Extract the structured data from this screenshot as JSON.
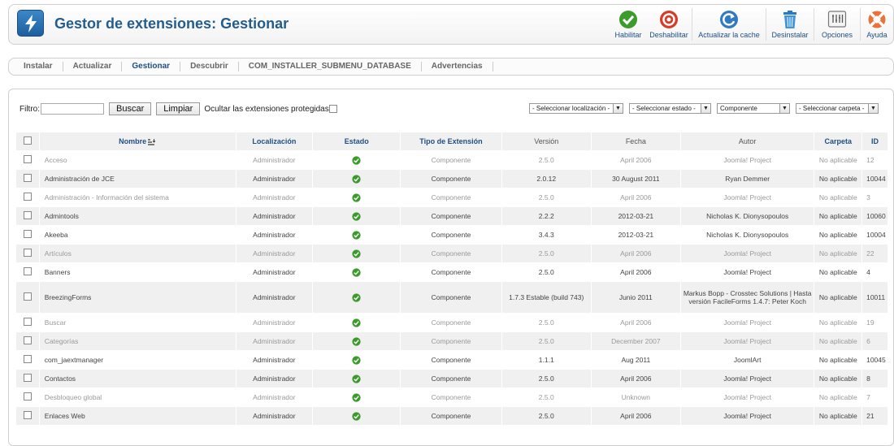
{
  "header": {
    "title": "Gestor de extensiones: Gestionar",
    "toolbar": [
      {
        "label": "Habilitar",
        "icon": "check-circle-icon"
      },
      {
        "label": "Deshabilitar",
        "icon": "stop-circle-icon"
      },
      {
        "label": "Actualizar la cache",
        "icon": "refresh-icon"
      },
      {
        "label": "Desinstalar",
        "icon": "trash-icon"
      },
      {
        "label": "Opciones",
        "icon": "options-icon"
      },
      {
        "label": "Ayuda",
        "icon": "lifebuoy-icon"
      }
    ]
  },
  "submenu": [
    {
      "label": "Instalar",
      "active": false
    },
    {
      "label": "Actualizar",
      "active": false
    },
    {
      "label": "Gestionar",
      "active": true
    },
    {
      "label": "Descubrir",
      "active": false
    },
    {
      "label": "COM_INSTALLER_SUBMENU_DATABASE",
      "active": false
    },
    {
      "label": "Advertencias",
      "active": false
    }
  ],
  "filter": {
    "label": "Filtro:",
    "value": "",
    "search_button": "Buscar",
    "clear_button": "Limpiar",
    "hide_protected_label": "Ocultar las extensiones protegidas"
  },
  "selects": {
    "location": "- Seleccionar localización -",
    "state": "- Seleccionar estado -",
    "type": "Componente",
    "folder": "- Seleccionar carpeta -"
  },
  "table": {
    "columns": [
      "Nombre",
      "Localización",
      "Estado",
      "Tipo de Extensión",
      "Versión",
      "Fecha",
      "Autor",
      "Carpeta",
      "ID"
    ],
    "rows": [
      {
        "name": "Acceso",
        "location": "Administrador",
        "type": "Componente",
        "version": "2.5.0",
        "date": "April 2006",
        "author": "Joomla! Project",
        "folder": "No aplicable",
        "id": "12",
        "protected": true
      },
      {
        "name": "Administración de JCE",
        "location": "Administrador",
        "type": "Componente",
        "version": "2.0.12",
        "date": "30 August 2011",
        "author": "Ryan Demmer",
        "folder": "No aplicable",
        "id": "10044",
        "protected": false
      },
      {
        "name": "Administración - Información del sistema",
        "location": "Administrador",
        "type": "Componente",
        "version": "2.5.0",
        "date": "April 2006",
        "author": "Joomla! Project",
        "folder": "No aplicable",
        "id": "3",
        "protected": true
      },
      {
        "name": "Admintools",
        "location": "Administrador",
        "type": "Componente",
        "version": "2.2.2",
        "date": "2012-03-21",
        "author": "Nicholas K. Dionysopoulos",
        "folder": "No aplicable",
        "id": "10060",
        "protected": false
      },
      {
        "name": "Akeeba",
        "location": "Administrador",
        "type": "Componente",
        "version": "3.4.3",
        "date": "2012-03-21",
        "author": "Nicholas K. Dionysopoulos",
        "folder": "No aplicable",
        "id": "10004",
        "protected": false
      },
      {
        "name": "Artículos",
        "location": "Administrador",
        "type": "Componente",
        "version": "2.5.0",
        "date": "April 2006",
        "author": "Joomla! Project",
        "folder": "No aplicable",
        "id": "22",
        "protected": true
      },
      {
        "name": "Banners",
        "location": "Administrador",
        "type": "Componente",
        "version": "2.5.0",
        "date": "April 2006",
        "author": "Joomla! Project",
        "folder": "No aplicable",
        "id": "4",
        "protected": false
      },
      {
        "name": "BreezingForms",
        "location": "Administrador",
        "type": "Componente",
        "version": "1.7.3 Estable (build 743)",
        "date": "Junio 2011",
        "author": "Markus Bopp - Crosstec Solutions | Hasta versión FacileForms 1.4.7: Peter Koch",
        "folder": "No aplicable",
        "id": "10011",
        "protected": false,
        "tall": true
      },
      {
        "name": "Buscar",
        "location": "Administrador",
        "type": "Componente",
        "version": "2.5.0",
        "date": "April 2006",
        "author": "Joomla! Project",
        "folder": "No aplicable",
        "id": "19",
        "protected": true
      },
      {
        "name": "Categorías",
        "location": "Administrador",
        "type": "Componente",
        "version": "2.5.0",
        "date": "December 2007",
        "author": "Joomla! Project",
        "folder": "No aplicable",
        "id": "6",
        "protected": true
      },
      {
        "name": "com_jaextmanager",
        "location": "Administrador",
        "type": "Componente",
        "version": "1.1.1",
        "date": "Aug 2011",
        "author": "JoomlArt",
        "folder": "No aplicable",
        "id": "10045",
        "protected": false
      },
      {
        "name": "Contactos",
        "location": "Administrador",
        "type": "Componente",
        "version": "2.5.0",
        "date": "April 2006",
        "author": "Joomla! Project",
        "folder": "No aplicable",
        "id": "8",
        "protected": false
      },
      {
        "name": "Desbloqueo global",
        "location": "Administrador",
        "type": "Componente",
        "version": "2.5.0",
        "date": "Unknown",
        "author": "Joomla! Project",
        "folder": "No aplicable",
        "id": "7",
        "protected": true
      },
      {
        "name": "Enlaces Web",
        "location": "Administrador",
        "type": "Componente",
        "version": "2.5.0",
        "date": "April 2006",
        "author": "Joomla! Project",
        "folder": "No aplicable",
        "id": "21",
        "protected": false
      }
    ]
  },
  "colors": {
    "title": "#235d8f",
    "link": "#1d4f85",
    "enabled": "#3a9a2a",
    "row_alt": "#f0f0f0"
  }
}
